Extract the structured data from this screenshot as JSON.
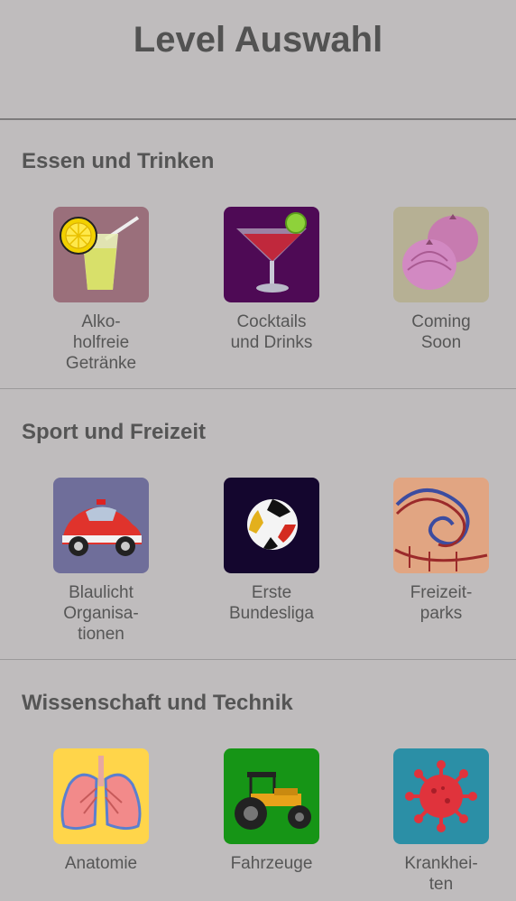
{
  "header": {
    "title": "Level Auswahl"
  },
  "sections": [
    {
      "title": "Essen und Trinken",
      "tiles": [
        {
          "label": "Alko-\nholfreie\nGetränke",
          "icon": "lemonade-icon",
          "bg": "#9a6f7b"
        },
        {
          "label": "Cocktails\nund Drinks",
          "icon": "cocktail-icon",
          "bg": "#4e0a55"
        },
        {
          "label": "Coming\nSoon",
          "icon": "onion-icon",
          "bg": "#b6b094"
        }
      ]
    },
    {
      "title": "Sport und Freizeit",
      "tiles": [
        {
          "label": "Blaulicht\nOrganisa-\ntionen",
          "icon": "fire-beetle-car-icon",
          "bg": "#6f6e9a"
        },
        {
          "label": "Erste\nBundesliga",
          "icon": "football-icon",
          "bg": "#14062e"
        },
        {
          "label": "Freizeit-\nparks",
          "icon": "rollercoaster-icon",
          "bg": "#e1a582"
        }
      ]
    },
    {
      "title": "Wissenschaft und Technik",
      "tiles": [
        {
          "label": "Anatomie",
          "icon": "lungs-icon",
          "bg": "#ffd54a"
        },
        {
          "label": "Fahrzeuge",
          "icon": "tractor-icon",
          "bg": "#169516"
        },
        {
          "label": "Krankhei-\nten",
          "icon": "virus-icon",
          "bg": "#2b8fa6"
        }
      ]
    }
  ]
}
